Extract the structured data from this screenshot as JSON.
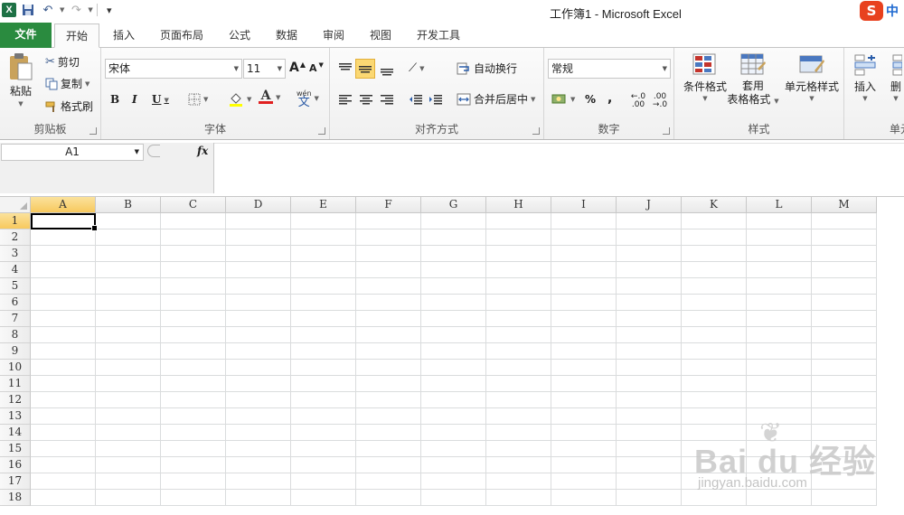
{
  "window": {
    "title": "工作簿1 - Microsoft Excel",
    "app_logo": "X",
    "ime_logo": "S",
    "ime_lang": "中"
  },
  "qat": {
    "save_icon": "💾",
    "undo_icon": "↶",
    "redo_icon": "↷",
    "customize_icon": "▾"
  },
  "tabs": [
    "文件",
    "开始",
    "插入",
    "页面布局",
    "公式",
    "数据",
    "审阅",
    "视图",
    "开发工具"
  ],
  "clipboard": {
    "paste": "粘贴",
    "cut": "剪切",
    "copy": "复制",
    "format_painter": "格式刷",
    "group_label": "剪贴板"
  },
  "font": {
    "font_name": "宋体",
    "font_size": "11",
    "bold": "B",
    "italic": "I",
    "underline": "U",
    "grow": "A",
    "shrink": "A",
    "font_color_letter": "A",
    "phonetic": "wén",
    "phonetic_char": "文",
    "group_label": "字体"
  },
  "alignment": {
    "wrap_text": "自动换行",
    "merge_center": "合并后居中",
    "group_label": "对齐方式"
  },
  "number": {
    "format": "常规",
    "percent": "%",
    "comma": ",",
    "inc_decimal": "←.0 .00",
    "dec_decimal": ".00 →.0",
    "group_label": "数字"
  },
  "styles": {
    "conditional": "条件格式",
    "table_format_line1": "套用",
    "table_format_line2": "表格格式",
    "cell_styles": "单元格样式",
    "group_label": "样式"
  },
  "cells": {
    "insert": "插入",
    "delete": "删",
    "group_label": "单元"
  },
  "formula_bar": {
    "name_box": "A1",
    "fx": "fx",
    "value": ""
  },
  "grid": {
    "columns": [
      "A",
      "B",
      "C",
      "D",
      "E",
      "F",
      "G",
      "H",
      "I",
      "J",
      "K",
      "L",
      "M"
    ],
    "rows": [
      "1",
      "2",
      "3",
      "4",
      "5",
      "6",
      "7",
      "8",
      "9",
      "10",
      "11",
      "12",
      "13",
      "14",
      "15",
      "16",
      "17",
      "18"
    ],
    "selected_column": "A",
    "selected_row": "1"
  },
  "watermark": {
    "main": "Bai du 经验",
    "sub": "jingyan.baidu.com"
  },
  "colors": {
    "file_tab": "#2a8b3f",
    "selection_header": "#f7c95e",
    "highlight_button": "#fbd873"
  }
}
